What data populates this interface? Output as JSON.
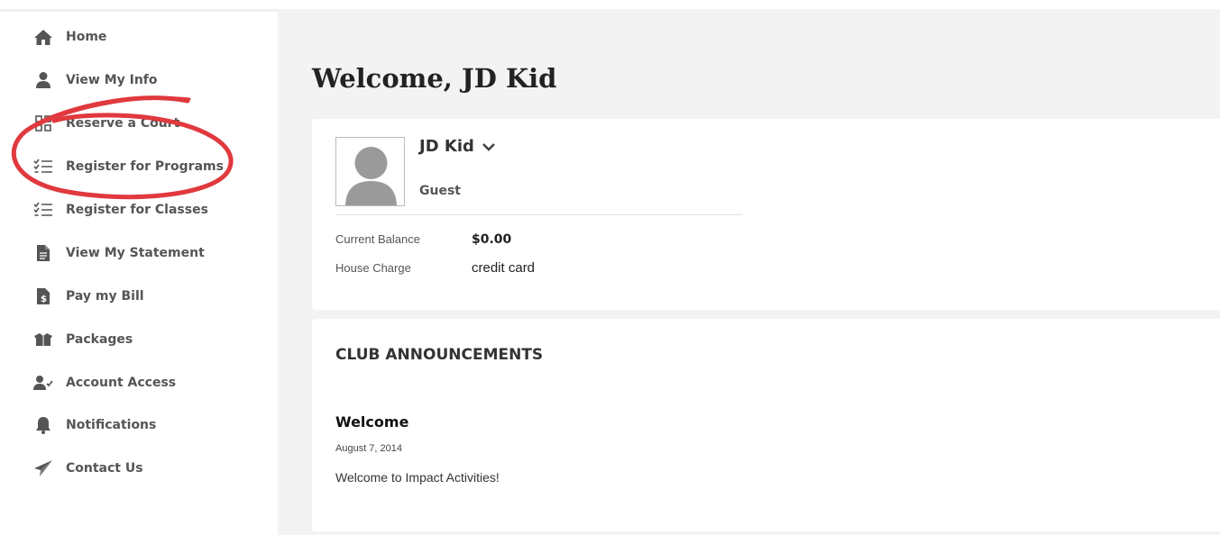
{
  "sidebar": {
    "items": [
      {
        "label": "Home",
        "icon": "home-icon"
      },
      {
        "label": "View My Info",
        "icon": "user-icon"
      },
      {
        "label": "Reserve a Court",
        "icon": "grid-icon"
      },
      {
        "label": "Register for Programs",
        "icon": "checklist-icon"
      },
      {
        "label": "Register for Classes",
        "icon": "checklist-icon"
      },
      {
        "label": "View My Statement",
        "icon": "document-icon"
      },
      {
        "label": "Pay my Bill",
        "icon": "bill-icon"
      },
      {
        "label": "Packages",
        "icon": "package-icon"
      },
      {
        "label": "Account Access",
        "icon": "user-check-icon"
      },
      {
        "label": "Notifications",
        "icon": "bell-icon"
      },
      {
        "label": "Contact Us",
        "icon": "paper-plane-icon"
      }
    ]
  },
  "main": {
    "title": "Welcome, JD Kid",
    "profile": {
      "name": "JD Kid",
      "role": "Guest",
      "balance_label": "Current Balance",
      "balance_value": "$0.00",
      "house_charge_label": "House Charge",
      "house_charge_value": "credit card"
    },
    "announcements": {
      "heading": "CLUB ANNOUNCEMENTS",
      "posts": [
        {
          "title": "Welcome",
          "date": "August 7, 2014",
          "body": "Welcome to Impact Activities!"
        }
      ]
    }
  },
  "colors": {
    "annotation": "#e0393e",
    "main_bg": "#f3f3f3",
    "icon": "#555555"
  }
}
